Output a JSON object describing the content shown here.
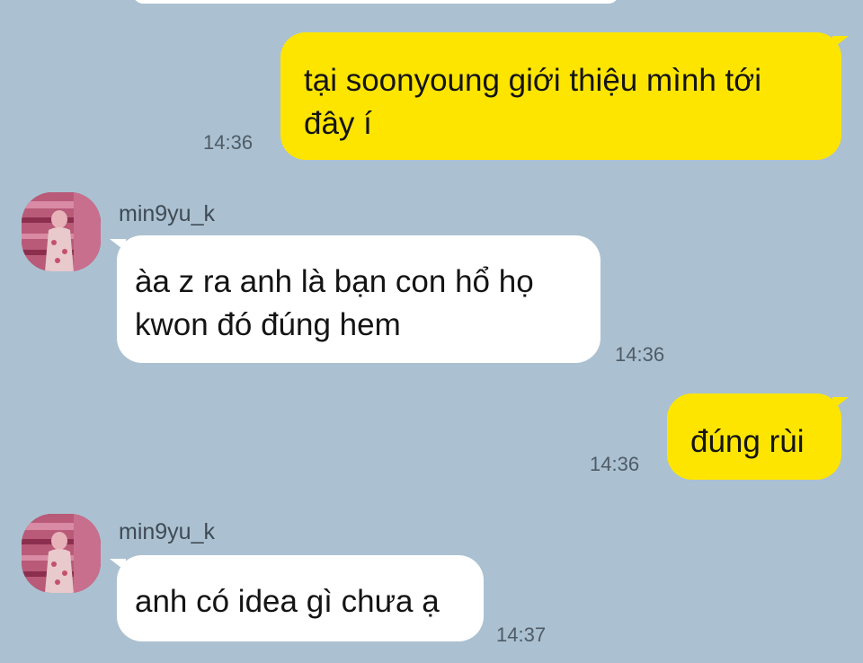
{
  "chat": {
    "messages": [
      {
        "side": "out",
        "text_line1": "tại soonyoung giới thiệu mình tới",
        "text_line2": "đây í",
        "time": "14:36"
      },
      {
        "side": "in",
        "sender": "min9yu_k",
        "text_line1": "àa z ra anh là bạn con hổ họ",
        "text_line2": "kwon đó đúng hem",
        "time": "14:36"
      },
      {
        "side": "out",
        "text_line1": "đúng rùi",
        "time": "14:36"
      },
      {
        "side": "in",
        "sender": "min9yu_k",
        "text_line1": "anh có idea gì chưa ạ",
        "time": "14:37"
      }
    ],
    "colors": {
      "background": "#abc1d1",
      "outgoing_bubble": "#fee500",
      "incoming_bubble": "#ffffff"
    },
    "avatar_icon": "profile-photo"
  }
}
